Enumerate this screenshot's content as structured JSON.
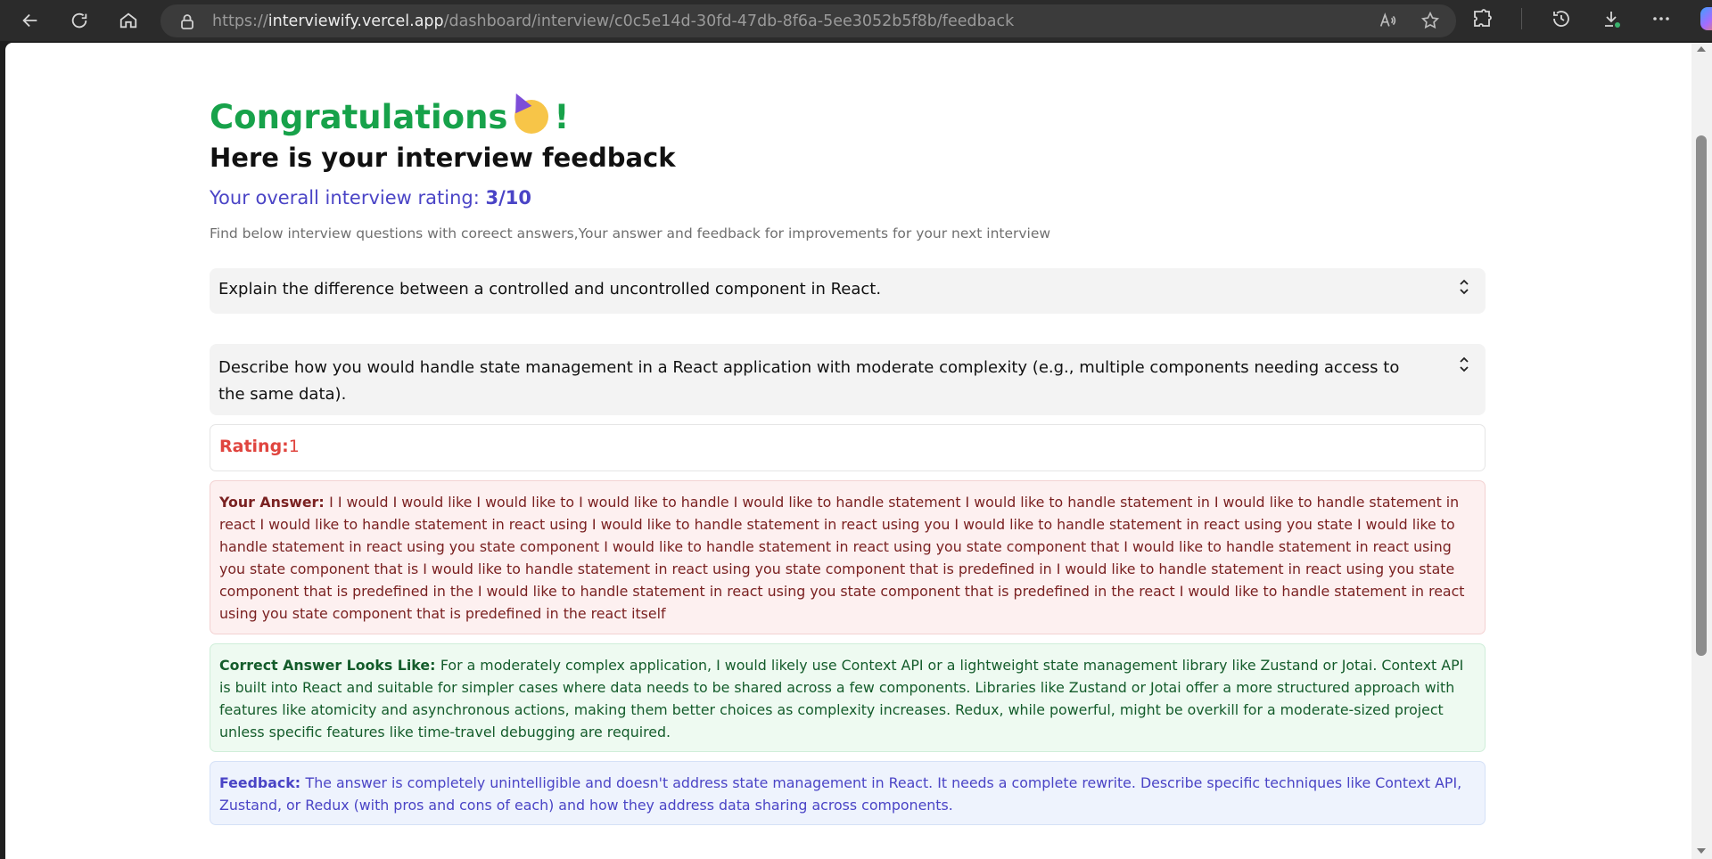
{
  "browser": {
    "url_scheme": "https://",
    "url_host": "interviewify.vercel.app",
    "url_path": "/dashboard/interview/c0c5e14d-30fd-47db-8f6a-5ee3052b5f8b/feedback"
  },
  "page": {
    "congrats_title": "Congratulations",
    "congrats_suffix": "!",
    "subtitle": "Here is your interview feedback",
    "rating_label": "Your overall interview rating: ",
    "rating_value": "3/10",
    "description": "Find below interview questions with coreect answers,Your answer and feedback for improvements for your next interview"
  },
  "questions": [
    {
      "text": "Explain the difference between a controlled and uncontrolled component in React."
    },
    {
      "text": "Describe how you would handle state management in a React application with moderate complexity (e.g., multiple components needing access to the same data).",
      "rating_label": "Rating:",
      "rating_value": "1",
      "answer_label": "Your Answer: ",
      "answer_text": "I I would I would like I would like to I would like to handle I would like to handle statement I would like to handle statement in I would like to handle statement in react I would like to handle statement in react using I would like to handle statement in react using you I would like to handle statement in react using you state I would like to handle statement in react using you state component I would like to handle statement in react using you state component that I would like to handle statement in react using you state component that is I would like to handle statement in react using you state component that is predefined in I would like to handle statement in react using you state component that is predefined in the I would like to handle statement in react using you state component that is predefined in the react I would like to handle statement in react using you state component that is predefined in the react itself",
      "correct_label": "Correct Answer Looks Like: ",
      "correct_text": "For a moderately complex application, I would likely use Context API or a lightweight state management library like Zustand or Jotai. Context API is built into React and suitable for simpler cases where data needs to be shared across a few components. Libraries like Zustand or Jotai offer a more structured approach with features like atomicity and asynchronous actions, making them better choices as complexity increases. Redux, while powerful, might be overkill for a moderate-sized project unless specific features like time-travel debugging are required.",
      "feedback_label": "Feedback: ",
      "feedback_text": "The answer is completely unintelligible and doesn't address state management in React. It needs a complete rewrite. Describe specific techniques like Context API, Zustand, or Redux (with pros and cons of each) and how they address data sharing across components."
    }
  ],
  "icons": {
    "back": "back-arrow-icon",
    "refresh": "refresh-icon",
    "home": "home-icon",
    "lock": "lock-icon",
    "read_aloud": "read-aloud-icon",
    "favorite": "star-icon",
    "extensions": "puzzle-icon",
    "history": "history-icon",
    "downloads": "download-icon",
    "more": "more-icon",
    "copilot": "copilot-icon",
    "expand": "chevron-up-down-icon",
    "emoji": "party-face-emoji"
  },
  "colors": {
    "green": "#17a24a",
    "indigo": "#4a44c6",
    "red": "#e0453f"
  }
}
